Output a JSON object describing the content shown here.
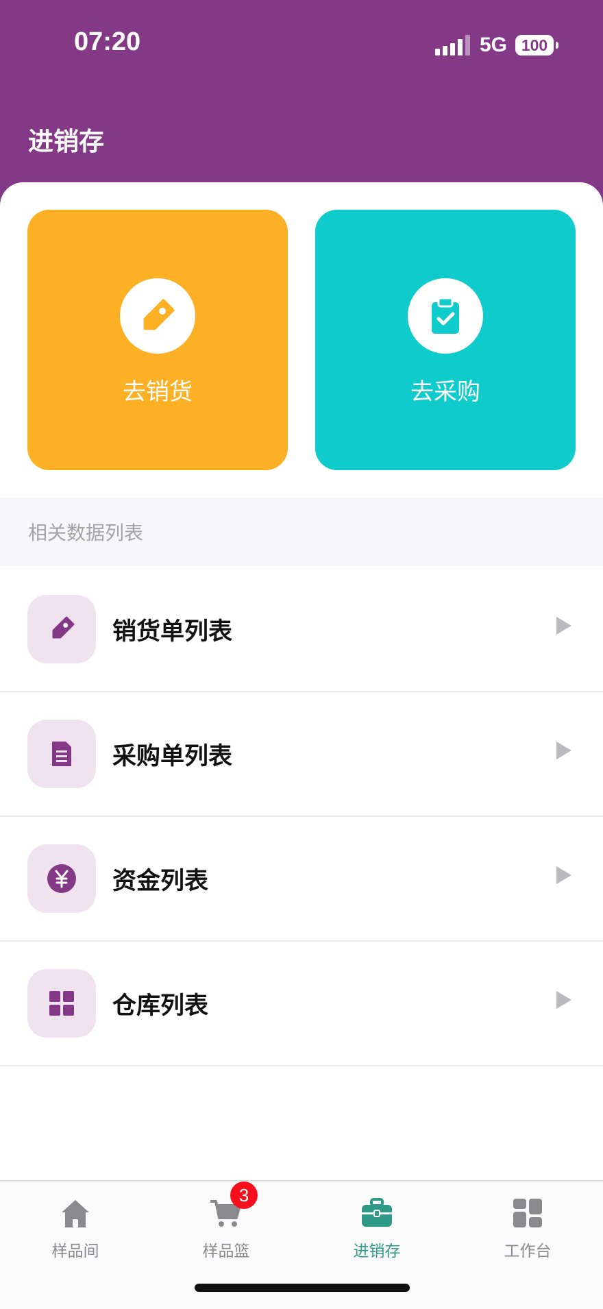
{
  "status_bar": {
    "time": "07:20",
    "network": "5G",
    "battery": "100"
  },
  "header": {
    "title": "进销存"
  },
  "actions": {
    "sell": {
      "label": "去销货",
      "color": "#fdb023"
    },
    "buy": {
      "label": "去采购",
      "color": "#10cbcb"
    }
  },
  "section": {
    "title": "相关数据列表"
  },
  "list": [
    {
      "label": "销货单列表",
      "icon": "tag-icon"
    },
    {
      "label": "采购单列表",
      "icon": "document-icon"
    },
    {
      "label": "资金列表",
      "icon": "yen-icon"
    },
    {
      "label": "仓库列表",
      "icon": "grid-icon"
    }
  ],
  "tabs": [
    {
      "label": "样品间",
      "icon": "home-icon"
    },
    {
      "label": "样品篮",
      "icon": "cart-icon",
      "badge": "3"
    },
    {
      "label": "进销存",
      "icon": "briefcase-icon",
      "active": true
    },
    {
      "label": "工作台",
      "icon": "dashboard-icon"
    }
  ],
  "colors": {
    "brand": "#843987",
    "active_tab": "#2f9a87",
    "badge": "#f70f1e"
  }
}
